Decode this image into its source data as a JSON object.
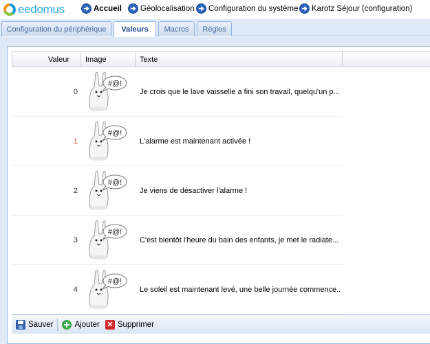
{
  "brand": {
    "logo_text": "eedomus"
  },
  "nav": {
    "items": [
      {
        "label": "Accueil",
        "icon": "circle-arrow-icon"
      },
      {
        "label": "Géolocalisation",
        "icon": "circle-arrow-icon"
      },
      {
        "label": "Configuration du système",
        "icon": "circle-arrow-icon"
      },
      {
        "label": "Karotz Séjour (configuration)",
        "icon": "circle-arrow-icon"
      }
    ]
  },
  "tabs": [
    {
      "label": "Configuration du périphérique",
      "active": false
    },
    {
      "label": "Valeurs",
      "active": true
    },
    {
      "label": "Macros",
      "active": false
    },
    {
      "label": "Règles",
      "active": false
    }
  ],
  "grid": {
    "columns": [
      "Valeur",
      "Image",
      "Texte"
    ],
    "rows": [
      {
        "valeur": "0",
        "image": "karotz-rabbit-speech-icon",
        "texte": "Je crois que le lave vaisselle a fini son travail, quelqu'un p..."
      },
      {
        "valeur": "1",
        "image": "karotz-rabbit-speech-icon",
        "texte": "L'alarme est maintenant activée !"
      },
      {
        "valeur": "2",
        "image": "karotz-rabbit-speech-icon",
        "texte": "Je viens de désactiver l'alarme !"
      },
      {
        "valeur": "3",
        "image": "karotz-rabbit-speech-icon",
        "texte": "C'est bientôt l'heure du bain des enfants, je met le radiate..."
      },
      {
        "valeur": "4",
        "image": "karotz-rabbit-speech-icon",
        "texte": "Le soleil est maintenant levé, une belle journée commence..."
      }
    ],
    "bubble_text": "#@!"
  },
  "toolbar": {
    "save_label": "Sauver",
    "add_label": "Ajouter",
    "delete_label": "Supprimer"
  },
  "colors": {
    "accent": "#15428b",
    "tab_border": "#99bbe8",
    "panel_bg": "#dfe8f6",
    "logo_blue": "#27a5dd"
  }
}
